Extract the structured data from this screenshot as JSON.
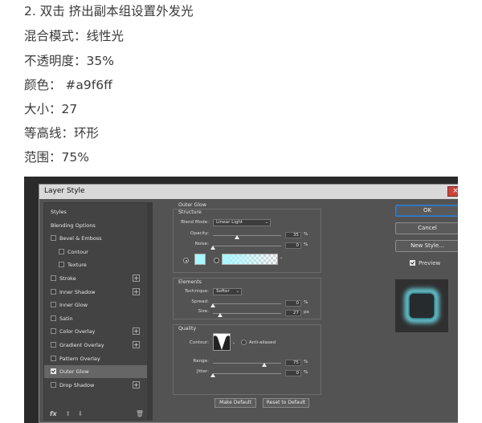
{
  "notes": [
    "2. 双击 挤出副本组设置外发光",
    "混合模式：线性光",
    "不透明度：35%",
    "颜色： #a9f6ff",
    "大小：27",
    "等高线：环形",
    "范围：75%"
  ],
  "dialog": {
    "title": "Layer Style",
    "close_label": "×",
    "styles_list": [
      {
        "label": "Styles",
        "checkbox": false,
        "plus": false
      },
      {
        "label": "Blending Options",
        "checkbox": false,
        "plus": false
      },
      {
        "label": "Bevel & Emboss",
        "checkbox": true,
        "checked": false,
        "plus": false
      },
      {
        "label": "Contour",
        "checkbox": true,
        "checked": false,
        "plus": false,
        "indent": true
      },
      {
        "label": "Texture",
        "checkbox": true,
        "checked": false,
        "plus": false,
        "indent": true
      },
      {
        "label": "Stroke",
        "checkbox": true,
        "checked": false,
        "plus": true
      },
      {
        "label": "Inner Shadow",
        "checkbox": true,
        "checked": false,
        "plus": true
      },
      {
        "label": "Inner Glow",
        "checkbox": true,
        "checked": false,
        "plus": false
      },
      {
        "label": "Satin",
        "checkbox": true,
        "checked": false,
        "plus": false
      },
      {
        "label": "Color Overlay",
        "checkbox": true,
        "checked": false,
        "plus": true
      },
      {
        "label": "Gradient Overlay",
        "checkbox": true,
        "checked": false,
        "plus": true
      },
      {
        "label": "Pattern Overlay",
        "checkbox": true,
        "checked": false,
        "plus": false
      },
      {
        "label": "Outer Glow",
        "checkbox": true,
        "checked": true,
        "plus": false,
        "selected": true
      },
      {
        "label": "Drop Shadow",
        "checkbox": true,
        "checked": false,
        "plus": true
      }
    ],
    "fx_label": "fx",
    "up_arrow": "⬆",
    "down_arrow": "⬇",
    "trash_icon": "🗑",
    "outer_glow": {
      "title": "Outer Glow",
      "structure": {
        "title": "Structure",
        "blend_mode_label": "Blend Mode:",
        "blend_mode_value": "Linear Light",
        "opacity_label": "Opacity:",
        "opacity_value": "35",
        "opacity_unit": "%",
        "opacity_level": 0.35,
        "noise_label": "Noise:",
        "noise_value": "0",
        "noise_unit": "%",
        "noise_level": 0,
        "glow_color": "#a9f6ff"
      },
      "elements": {
        "title": "Elements",
        "technique_label": "Technique:",
        "technique_value": "Softer",
        "spread_label": "Spread:",
        "spread_value": "0",
        "spread_unit": "%",
        "spread_level": 0,
        "size_label": "Size:",
        "size_value": "27",
        "size_unit": "px",
        "size_level": 0.11
      },
      "quality": {
        "title": "Quality",
        "contour_label": "Contour:",
        "anti_aliased_label": "Anti-aliased",
        "range_label": "Range:",
        "range_value": "75",
        "range_unit": "%",
        "range_level": 0.75,
        "jitter_label": "Jitter:",
        "jitter_value": "0",
        "jitter_unit": "%",
        "jitter_level": 0
      },
      "make_default_label": "Make Default",
      "reset_default_label": "Reset to Default"
    },
    "ok_label": "OK",
    "cancel_label": "Cancel",
    "new_style_label": "New Style...",
    "preview_label": "Preview"
  }
}
